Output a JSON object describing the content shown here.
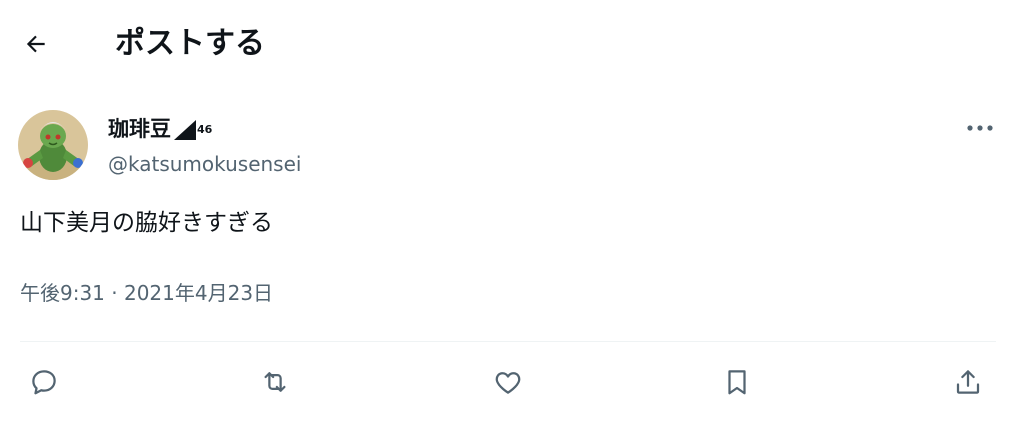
{
  "header": {
    "title": "ポストする",
    "back_icon": "arrow-left-icon"
  },
  "author": {
    "display_name": "珈琲豆",
    "signal_label": "46",
    "handle": "@katsumokusensei",
    "avatar_icon": "avatar-image"
  },
  "tweet": {
    "text": "山下美月の脇好きすぎる",
    "timestamp": "午後9:31 · 2021年4月23日"
  },
  "actions": [
    {
      "icon": "reply-icon"
    },
    {
      "icon": "retweet-icon"
    },
    {
      "icon": "like-icon"
    },
    {
      "icon": "bookmark-icon"
    },
    {
      "icon": "share-icon"
    }
  ],
  "colors": {
    "text": "#0f1419",
    "secondary": "#536471",
    "icon": "#536471",
    "divider": "#eff3f4"
  }
}
